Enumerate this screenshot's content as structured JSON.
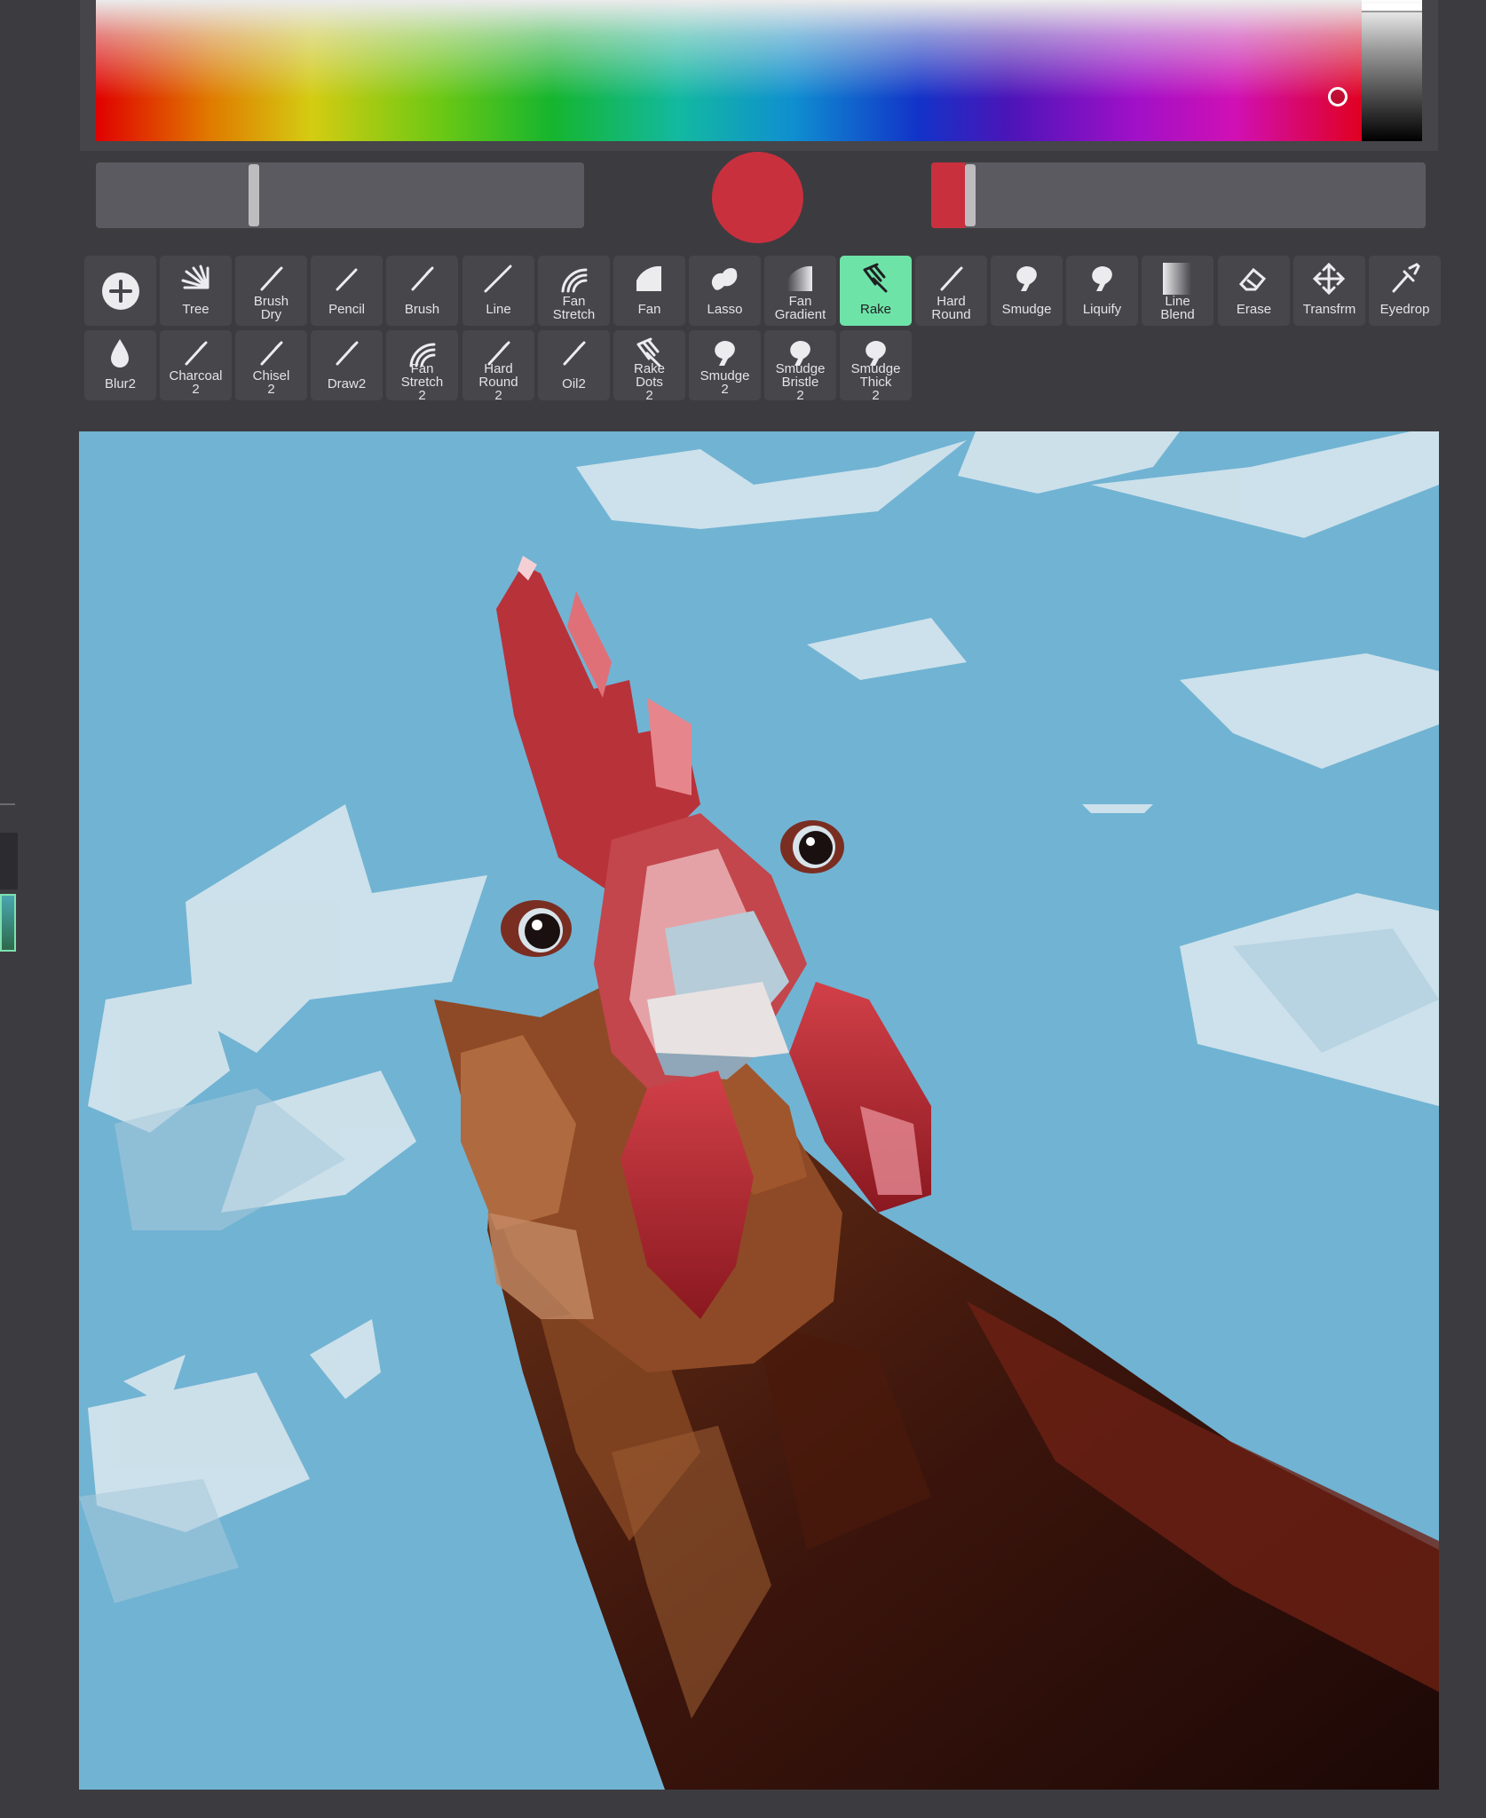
{
  "colors": {
    "current": "#c9303e",
    "active_tool": "#6ee3a8",
    "app_background": "#3c3c40",
    "canvas_sky": "#71b3d3"
  },
  "color_picker": {
    "size_level": 0.32,
    "opacity_level": 0.07
  },
  "tools_row1": [
    {
      "name": "add-brush-button",
      "label": "",
      "icon": "plus-circle-icon"
    },
    {
      "name": "tool-tree",
      "label": "Tree",
      "icon": "tree-brush-icon"
    },
    {
      "name": "tool-brush-dry",
      "label": "Brush\nDry",
      "icon": "brush-icon"
    },
    {
      "name": "tool-pencil",
      "label": "Pencil",
      "icon": "pencil-icon"
    },
    {
      "name": "tool-brush",
      "label": "Brush",
      "icon": "brush-icon"
    },
    {
      "name": "tool-line",
      "label": "Line",
      "icon": "line-icon"
    },
    {
      "name": "tool-fan-stretch",
      "label": "Fan\nStretch",
      "icon": "fan-stretch-icon"
    },
    {
      "name": "tool-fan",
      "label": "Fan",
      "icon": "fan-icon"
    },
    {
      "name": "tool-lasso",
      "label": "Lasso",
      "icon": "lasso-icon"
    },
    {
      "name": "tool-fan-gradient",
      "label": "Fan\nGradient",
      "icon": "fan-gradient-icon"
    },
    {
      "name": "tool-rake",
      "label": "Rake",
      "icon": "rake-icon",
      "active": true
    },
    {
      "name": "tool-hard-round",
      "label": "Hard\nRound",
      "icon": "brush-icon"
    },
    {
      "name": "tool-smudge",
      "label": "Smudge",
      "icon": "smudge-icon"
    },
    {
      "name": "tool-liquify",
      "label": "Liquify",
      "icon": "smudge-icon"
    },
    {
      "name": "tool-line-blend",
      "label": "Line\nBlend",
      "icon": "line-blend-icon"
    },
    {
      "name": "tool-erase",
      "label": "Erase",
      "icon": "eraser-icon"
    },
    {
      "name": "tool-transfrm",
      "label": "Transfrm",
      "icon": "move-icon"
    },
    {
      "name": "tool-eyedrop",
      "label": "Eyedrop",
      "icon": "eyedropper-icon"
    }
  ],
  "tools_row2": [
    {
      "name": "tool-blur2",
      "label": "Blur2",
      "icon": "drop-icon"
    },
    {
      "name": "tool-charcoal-2",
      "label": "Charcoal\n2",
      "icon": "brush-icon"
    },
    {
      "name": "tool-chisel-2",
      "label": "Chisel\n2",
      "icon": "brush-icon"
    },
    {
      "name": "tool-draw2",
      "label": "Draw2",
      "icon": "brush-icon"
    },
    {
      "name": "tool-fan-stretch-2",
      "label": "Fan\nStretch\n2",
      "icon": "fan-stretch-icon"
    },
    {
      "name": "tool-hard-round-2",
      "label": "Hard\nRound\n2",
      "icon": "brush-icon"
    },
    {
      "name": "tool-oil2",
      "label": "Oil2",
      "icon": "brush-icon"
    },
    {
      "name": "tool-rake-dots-2",
      "label": "Rake\nDots\n2",
      "icon": "rake-icon"
    },
    {
      "name": "tool-smudge-2",
      "label": "Smudge\n2",
      "icon": "smudge-icon"
    },
    {
      "name": "tool-smudge-bristle-2",
      "label": "Smudge\nBristle\n2",
      "icon": "smudge-icon"
    },
    {
      "name": "tool-smudge-thick-2",
      "label": "Smudge\nThick\n2",
      "icon": "smudge-icon"
    }
  ]
}
